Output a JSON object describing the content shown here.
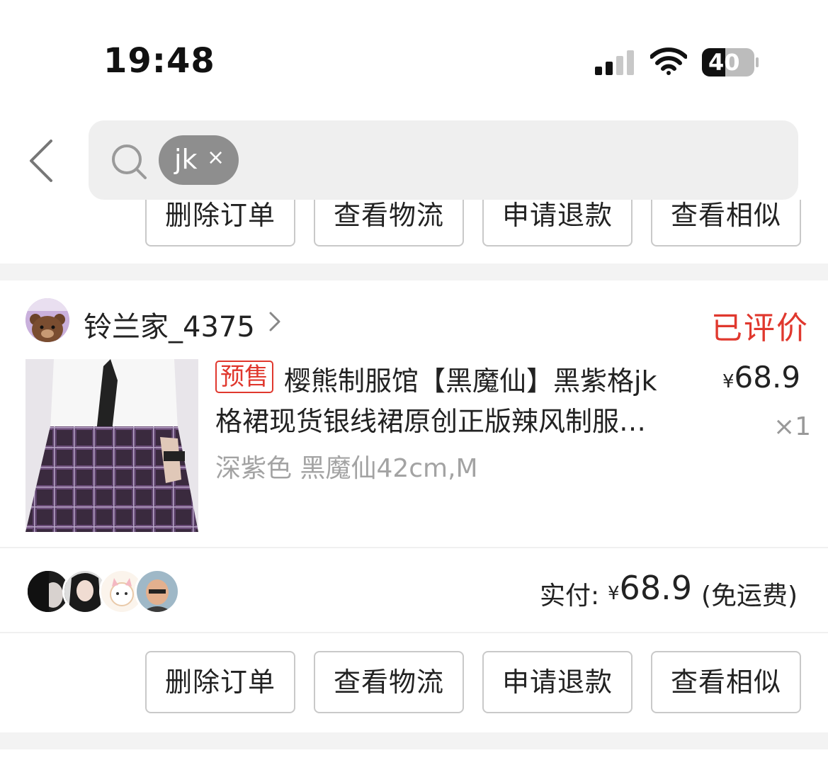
{
  "status_bar": {
    "time": "19:48",
    "battery": "40"
  },
  "search": {
    "chip_text": "jk",
    "chip_close": "×"
  },
  "actions": [
    "删除订单",
    "查看物流",
    "申请退款",
    "查看相似"
  ],
  "order": {
    "shop_name": "铃兰家_4375",
    "status": "已评价",
    "product": {
      "tag": "预售",
      "title_line1": "樱熊制服馆【黑魔仙】黑紫格jk",
      "title_line2": "格裙现货银线裙原创正版辣风制服…",
      "variant": "深紫色 黑魔仙42cm,M",
      "currency": "¥",
      "price": "68.9",
      "quantity": "×1"
    },
    "payment": {
      "label": "实付:",
      "currency": "¥",
      "amount": "68.9",
      "note": "(免运费)"
    }
  },
  "colors": {
    "accent": "#e0382e",
    "chip": "#8e8e8e",
    "search_bg": "#efefef"
  }
}
